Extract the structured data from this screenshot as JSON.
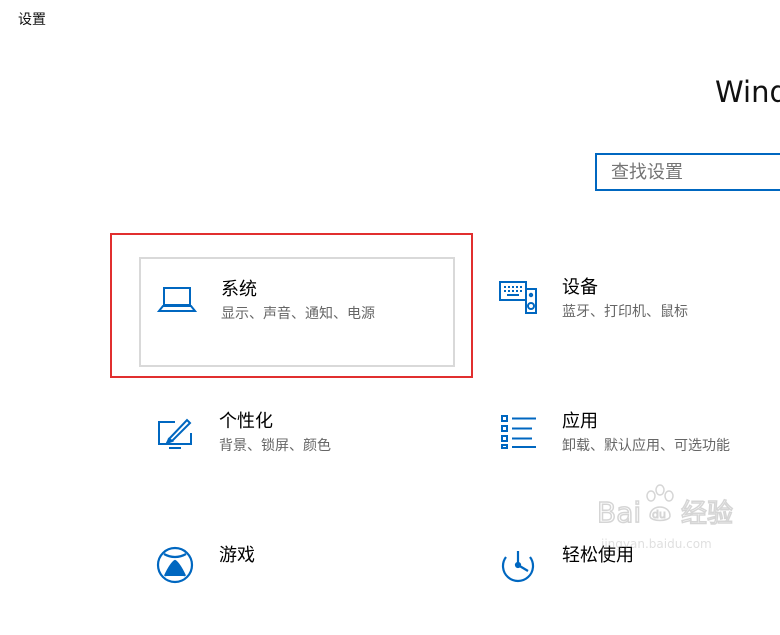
{
  "window": {
    "title": "设置"
  },
  "heading": "Wind",
  "search": {
    "placeholder": "查找设置"
  },
  "tiles": [
    {
      "id": "system",
      "icon": "laptop-icon",
      "title": "系统",
      "desc": "显示、声音、通知、电源",
      "highlighted": true
    },
    {
      "id": "devices",
      "icon": "keyboard-speaker-icon",
      "title": "设备",
      "desc": "蓝牙、打印机、鼠标"
    },
    {
      "id": "personalization",
      "icon": "pen-tablet-icon",
      "title": "个性化",
      "desc": "背景、锁屏、颜色"
    },
    {
      "id": "apps",
      "icon": "list-icon",
      "title": "应用",
      "desc": "卸载、默认应用、可选功能"
    },
    {
      "id": "gaming",
      "icon": "xbox-icon",
      "title": "游戏",
      "desc": ""
    },
    {
      "id": "ease-of-access",
      "icon": "ease-of-access-icon",
      "title": "轻松使用",
      "desc": ""
    }
  ],
  "watermark": {
    "text": "Bai du 经验",
    "url_text": "jingyan.baidu.com"
  },
  "colors": {
    "accent": "#0067c0",
    "highlight_border": "#e12f2f"
  }
}
